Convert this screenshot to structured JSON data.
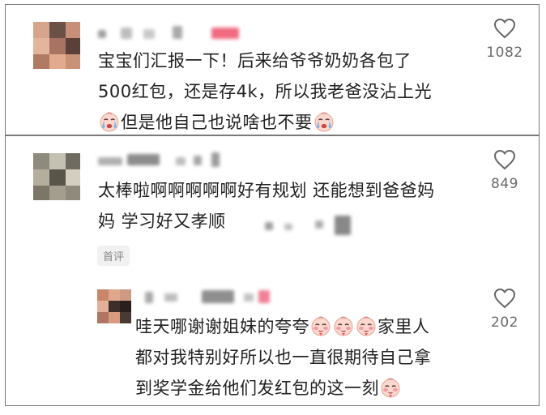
{
  "comments": [
    {
      "lines": [
        "宝宝们汇报一下！后来给爷爷奶奶各包了",
        "500红包，还是存4k，所以我老爸没沾上光"
      ],
      "tail_text": "但是他自己也说啥也不要",
      "like_count": "1082",
      "emoji": "crying-face"
    },
    {
      "lines": [
        "太棒啦啊啊啊啊啊好有规划 还能想到爸爸妈",
        "妈 学习好又孝顺"
      ],
      "badge": "首评",
      "like_count": "849"
    }
  ],
  "reply": {
    "line1_text": "哇天哪谢谢姐妹的夸夸",
    "line1_tail": "家里人",
    "lines": [
      "都对我特别好所以也一直很期待自己拿",
      "到奖学金给他们发红包的这一刻"
    ],
    "like_count": "202",
    "emoji": "blushing-face"
  },
  "colors": {
    "text": "#222222",
    "muted": "#6a6a6a",
    "border": "#7a7a7a",
    "badge_bg": "#f1f1f1",
    "blur_red": "#f06a80"
  }
}
